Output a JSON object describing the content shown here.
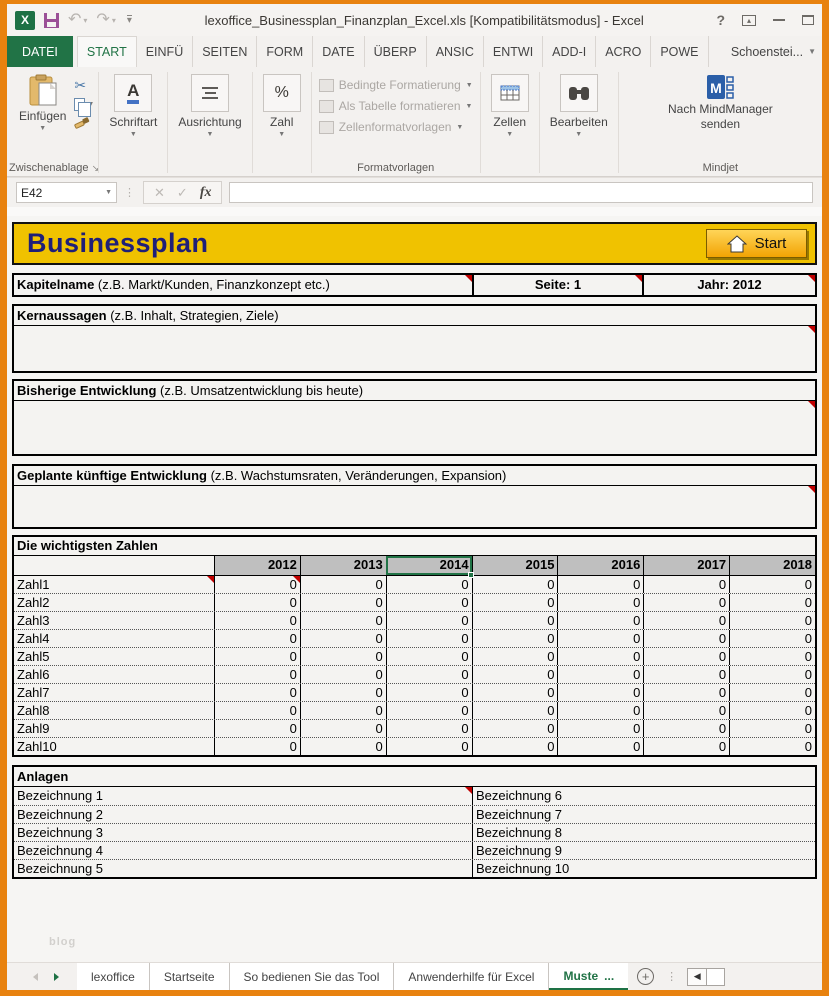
{
  "window": {
    "title": "lexoffice_Businessplan_Finanzplan_Excel.xls  [Kompatibilitätsmodus] - Excel",
    "help": "?"
  },
  "ribbon": {
    "tabs": [
      "DATEI",
      "START",
      "EINFÜ",
      "SEITEN",
      "FORM",
      "DATE",
      "ÜBERP",
      "ANSIC",
      "ENTWI",
      "ADD-I",
      "ACRO",
      "POWE"
    ],
    "account": "Schoenstei...",
    "einfuegen": "Einfügen",
    "zwischenablage": "Zwischenablage",
    "schriftart": "Schriftart",
    "ausrichtung": "Ausrichtung",
    "zahl": "Zahl",
    "formatvorlagen": [
      "Bedingte Formatierung",
      "Als Tabelle formatieren",
      "Zellenformatvorlagen"
    ],
    "formatvorlagen_label": "Formatvorlagen",
    "zellen": "Zellen",
    "bearbeiten": "Bearbeiten",
    "mindjet_button_line1": "Nach MindManager",
    "mindjet_button_line2": "senden",
    "mindjet_label": "Mindjet"
  },
  "formula_bar": {
    "name_box": "E42",
    "fx": "fx",
    "formula": ""
  },
  "sheet": {
    "title": "Businessplan",
    "start_button": "Start",
    "kapitel": {
      "bold": "Kapitelname",
      "rest": " (z.B. Markt/Kunden, Finanzkonzept etc.)",
      "seite": "Seite: 1",
      "jahr": "Jahr: 2012"
    },
    "sections": [
      {
        "bold": "Kernaussagen",
        "rest": " (z.B. Inhalt, Strategien, Ziele)"
      },
      {
        "bold": "Bisherige Entwicklung",
        "rest": " (z.B. Umsatzentwicklung bis heute)"
      },
      {
        "bold": "Geplante künftige Entwicklung",
        "rest": " (z.B. Wachstumsraten, Veränderungen, Expansion)"
      }
    ],
    "zahlen": {
      "title": "Die wichtigsten Zahlen",
      "years": [
        "2012",
        "2013",
        "2014",
        "2015",
        "2016",
        "2017",
        "2018"
      ],
      "selected_year": "2014",
      "rows": [
        {
          "label": "Zahl1",
          "values": [
            "0",
            "0",
            "0",
            "0",
            "0",
            "0",
            "0"
          ]
        },
        {
          "label": "Zahl2",
          "values": [
            "0",
            "0",
            "0",
            "0",
            "0",
            "0",
            "0"
          ]
        },
        {
          "label": "Zahl3",
          "values": [
            "0",
            "0",
            "0",
            "0",
            "0",
            "0",
            "0"
          ]
        },
        {
          "label": "Zahl4",
          "values": [
            "0",
            "0",
            "0",
            "0",
            "0",
            "0",
            "0"
          ]
        },
        {
          "label": "Zahl5",
          "values": [
            "0",
            "0",
            "0",
            "0",
            "0",
            "0",
            "0"
          ]
        },
        {
          "label": "Zahl6",
          "values": [
            "0",
            "0",
            "0",
            "0",
            "0",
            "0",
            "0"
          ]
        },
        {
          "label": "Zahl7",
          "values": [
            "0",
            "0",
            "0",
            "0",
            "0",
            "0",
            "0"
          ]
        },
        {
          "label": "Zahl8",
          "values": [
            "0",
            "0",
            "0",
            "0",
            "0",
            "0",
            "0"
          ]
        },
        {
          "label": "Zahl9",
          "values": [
            "0",
            "0",
            "0",
            "0",
            "0",
            "0",
            "0"
          ]
        },
        {
          "label": "Zahl10",
          "values": [
            "0",
            "0",
            "0",
            "0",
            "0",
            "0",
            "0"
          ]
        }
      ]
    },
    "anlagen": {
      "title": "Anlagen",
      "left": [
        "Bezeichnung 1",
        "Bezeichnung 2",
        "Bezeichnung 3",
        "Bezeichnung 4",
        "Bezeichnung 5"
      ],
      "right": [
        "Bezeichnung 6",
        "Bezeichnung 7",
        "Bezeichnung 8",
        "Bezeichnung 9",
        "Bezeichnung 10"
      ]
    },
    "watermark": "blog"
  },
  "sheet_tabs": {
    "items": [
      "lexoffice",
      "Startseite",
      "So bedienen Sie das Tool",
      "Anwenderhilfe für Excel"
    ],
    "active": "Muste",
    "active_ellipsis": "..."
  },
  "colors": {
    "accent_green": "#217346",
    "frame_orange": "#E8820F",
    "header_yellow": "#F0C200",
    "title_blue": "#1F1F78",
    "selection_green": "#217346",
    "comment_red": "#C00000",
    "year_header_gray": "#BFBFBF"
  }
}
